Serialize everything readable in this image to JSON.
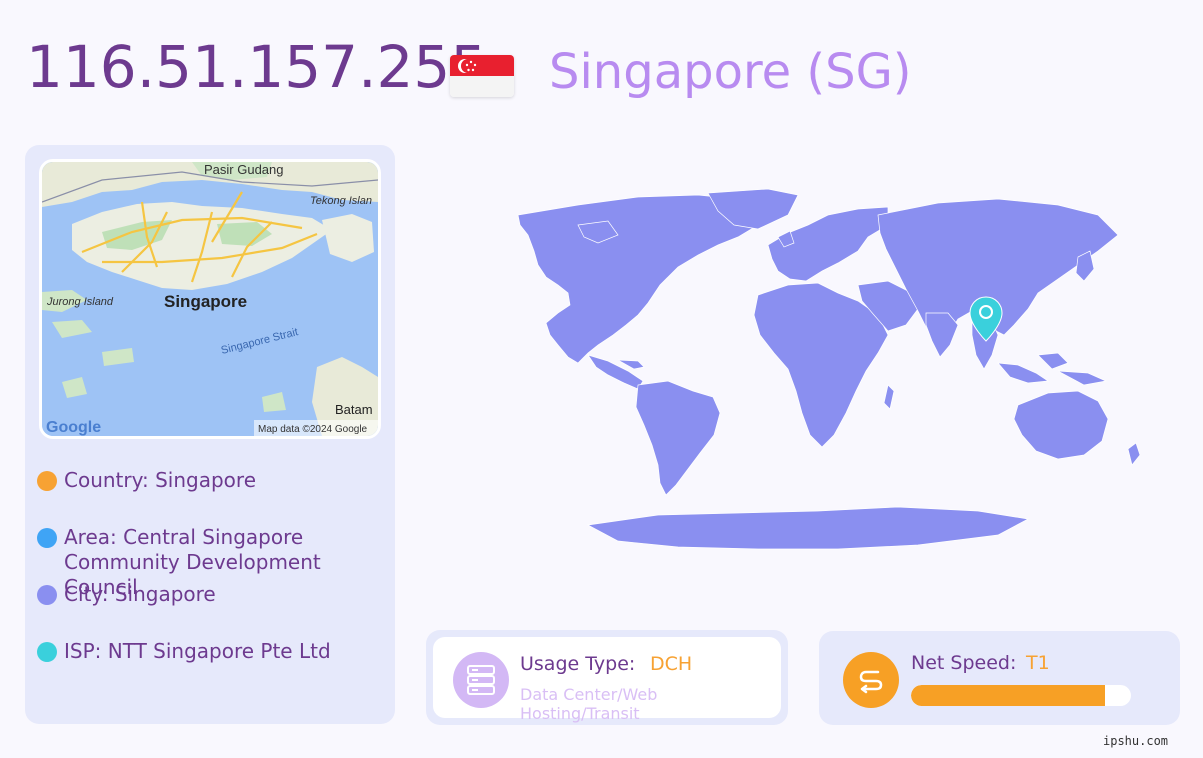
{
  "header": {
    "ip": "116.51.157.255",
    "country_label": "Singapore (SG)"
  },
  "mini_map": {
    "labels": {
      "pasir_gudang": "Pasir Gudang",
      "tekong": "Tekong Islan",
      "jurong": "Jurong Island",
      "singapore": "Singapore",
      "strait": "Singapore Strait",
      "batam": "Batam",
      "google": "Google",
      "attribution": "Map data ©2024 Google"
    }
  },
  "info": {
    "country": "Country: Singapore",
    "area_line1": "Area: Central Singapore",
    "area_line2": "Community Development Council",
    "city": "City: Singapore",
    "isp": "ISP: NTT Singapore Pte Ltd"
  },
  "colors": {
    "country_dot": "#f7a233",
    "area_dot": "#3fa4f5",
    "city_dot": "#8a8ff0",
    "isp_dot": "#3ad0dc",
    "map_land": "#8a8ff0",
    "pin": "#3ad0dc"
  },
  "usage": {
    "label": "Usage Type:",
    "value": "DCH",
    "description": "Data Center/Web Hosting/Transit",
    "icon": "server-icon"
  },
  "speed": {
    "label": "Net Speed:",
    "value": "T1",
    "icon": "speed-icon",
    "level_percent": 88
  },
  "footer": {
    "watermark": "ipshu.com"
  }
}
